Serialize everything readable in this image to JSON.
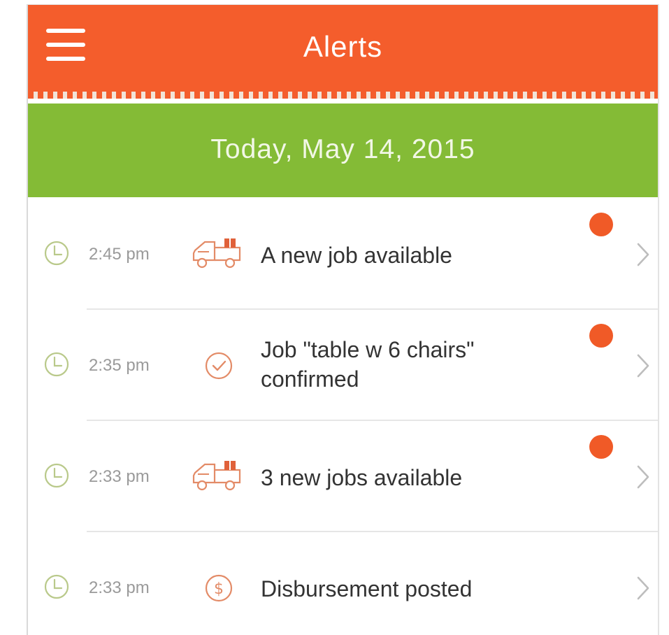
{
  "header": {
    "title": "Alerts",
    "menu_icon": "hamburger-menu-icon",
    "background_color": "#f45d2c"
  },
  "date_bar": {
    "text": "Today, May 14, 2015",
    "background_color": "#84bb36"
  },
  "alerts": [
    {
      "time": "2:45 pm",
      "type_icon": "delivery-truck-icon",
      "message": "A new job available",
      "unread": true
    },
    {
      "time": "2:35 pm",
      "type_icon": "check-circle-icon",
      "message": "Job \"table w 6 chairs\" confirmed",
      "unread": true
    },
    {
      "time": "2:33 pm",
      "type_icon": "delivery-truck-icon",
      "message": "3 new jobs available",
      "unread": true
    },
    {
      "time": "2:33 pm",
      "type_icon": "dollar-circle-icon",
      "message": "Disbursement posted",
      "unread": false
    }
  ],
  "colors": {
    "unread_dot": "#f05a27",
    "clock_icon": "#b9c98a",
    "type_icon": "#e38b67"
  }
}
